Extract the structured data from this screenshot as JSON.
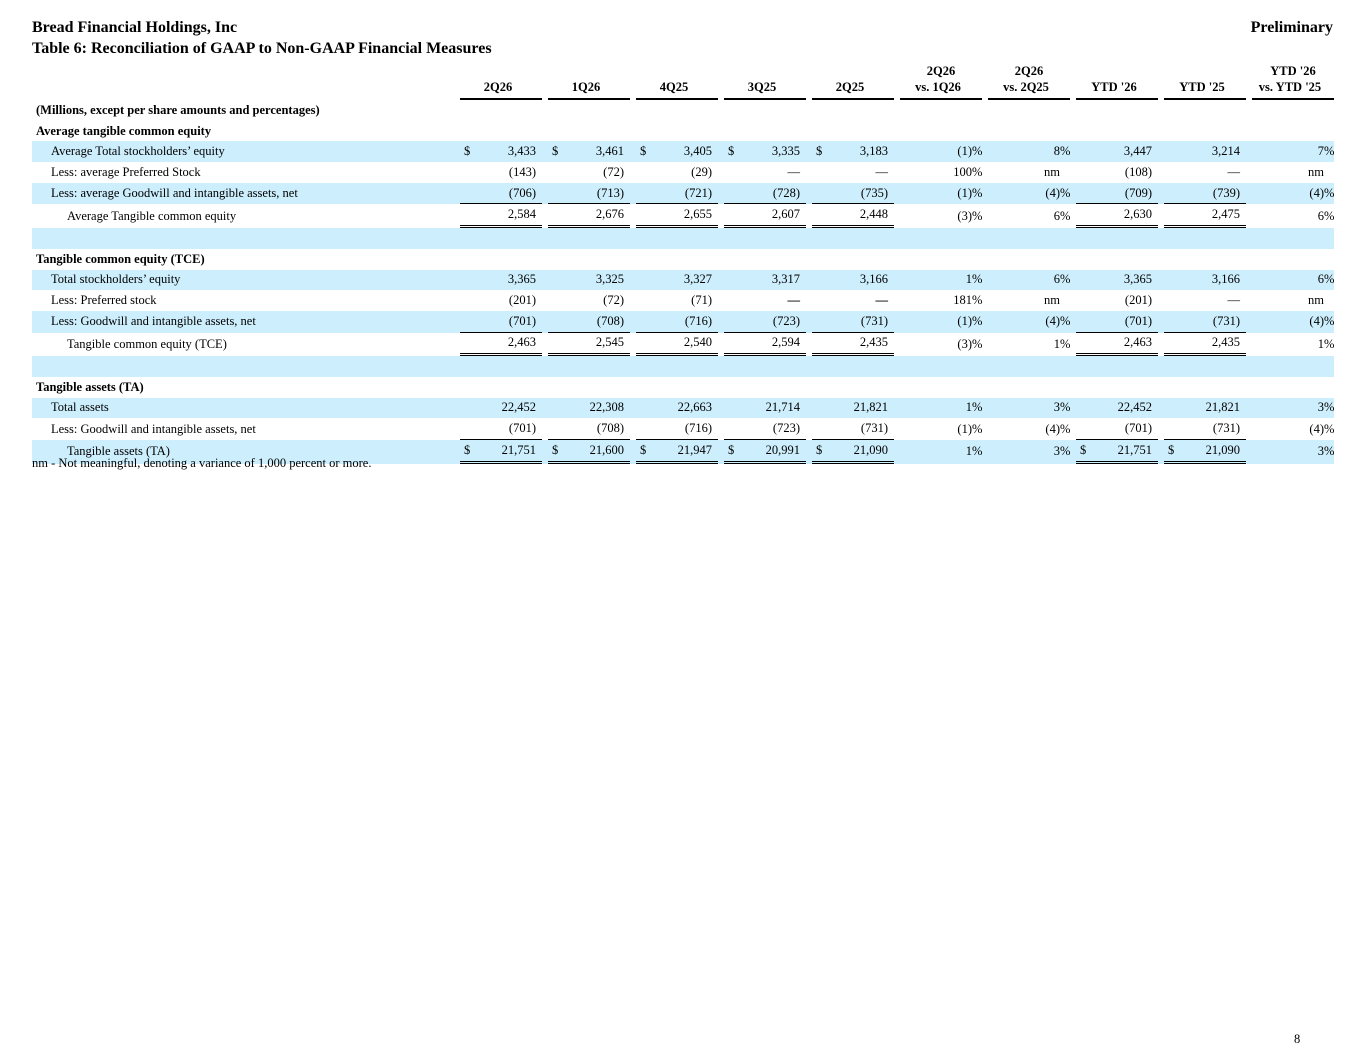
{
  "header": {
    "company": "Bread Financial Holdings, Inc",
    "status": "Preliminary",
    "table_title": "Table 6: Reconciliation of GAAP to Non-GAAP Financial Measures"
  },
  "columns": {
    "q1": "2Q26",
    "q2": "1Q26",
    "q3": "4Q25",
    "q4": "3Q25",
    "q5": "2Q25",
    "v1_top": "2Q26",
    "v1_bottom": "vs. 1Q26",
    "v2_top": "2Q26",
    "v2_bottom": "vs. 2Q25",
    "y1": "YTD '26",
    "y2": "YTD '25",
    "v3_top": "YTD '26",
    "v3_bottom": "vs. YTD '25"
  },
  "units_label": "(Millions, except per share amounts and percentages)",
  "currency_symbol": "$",
  "sections": {
    "atce": {
      "title": "Average tangible common equity",
      "r1": {
        "label": "Average Total stockholders’ equity",
        "q1": "3,433",
        "q2": "3,461",
        "q3": "3,405",
        "q4": "3,335",
        "q5": "3,183",
        "v1": "(1)",
        "v1t": "%",
        "v2": "8",
        "v2t": "%",
        "y1": "3,447",
        "y2": "3,214",
        "v3": "7",
        "v3t": "%"
      },
      "r2": {
        "label": "Less: average Preferred Stock",
        "q1": "(143)",
        "q2": "(72)",
        "q3": "(29)",
        "q4": "—",
        "q5": "—",
        "v1": "100",
        "v1t": "%",
        "v2": "nm",
        "v2t": "",
        "y1": "(108)",
        "y2": "—",
        "v3": "nm",
        "v3t": ""
      },
      "r3": {
        "label": "Less: average Goodwill and intangible assets, net",
        "q1": "(706)",
        "q2": "(713)",
        "q3": "(721)",
        "q4": "(728)",
        "q5": "(735)",
        "v1": "(1)",
        "v1t": "%",
        "v2": "(4)",
        "v2t": "%",
        "y1": "(709)",
        "y2": "(739)",
        "v3": "(4)",
        "v3t": "%"
      },
      "r4": {
        "label": "Average Tangible common equity",
        "q1": "2,584",
        "q2": "2,676",
        "q3": "2,655",
        "q4": "2,607",
        "q5": "2,448",
        "v1": "(3)",
        "v1t": "%",
        "v2": "6",
        "v2t": "%",
        "y1": "2,630",
        "y2": "2,475",
        "v3": "6",
        "v3t": "%"
      }
    },
    "tce": {
      "title": "Tangible common equity (TCE)",
      "r1": {
        "label": "Total stockholders’ equity",
        "q1": "3,365",
        "q2": "3,325",
        "q3": "3,327",
        "q4": "3,317",
        "q5": "3,166",
        "v1": "1",
        "v1t": "%",
        "v2": "6",
        "v2t": "%",
        "y1": "3,365",
        "y2": "3,166",
        "v3": "6",
        "v3t": "%"
      },
      "r2": {
        "label": "Less: Preferred stock",
        "q1": "(201)",
        "q2": "(72)",
        "q3": "(71)",
        "q4": "—",
        "q5": "—",
        "v1": "181",
        "v1t": "%",
        "v2": "nm",
        "v2t": "",
        "y1": "(201)",
        "y2": "—",
        "v3": "nm",
        "v3t": ""
      },
      "r3": {
        "label": "Less: Goodwill and intangible assets, net",
        "q1": "(701)",
        "q2": "(708)",
        "q3": "(716)",
        "q4": "(723)",
        "q5": "(731)",
        "v1": "(1)",
        "v1t": "%",
        "v2": "(4)",
        "v2t": "%",
        "y1": "(701)",
        "y2": "(731)",
        "v3": "(4)",
        "v3t": "%"
      },
      "r4": {
        "label": "Tangible common equity (TCE)",
        "q1": "2,463",
        "q2": "2,545",
        "q3": "2,540",
        "q4": "2,594",
        "q5": "2,435",
        "v1": "(3)",
        "v1t": "%",
        "v2": "1",
        "v2t": "%",
        "y1": "2,463",
        "y2": "2,435",
        "v3": "1",
        "v3t": "%"
      }
    },
    "ta": {
      "title": "Tangible assets (TA)",
      "r1": {
        "label": "Total assets",
        "q1": "22,452",
        "q2": "22,308",
        "q3": "22,663",
        "q4": "21,714",
        "q5": "21,821",
        "v1": "1",
        "v1t": "%",
        "v2": "3",
        "v2t": "%",
        "y1": "22,452",
        "y2": "21,821",
        "v3": "3",
        "v3t": "%"
      },
      "r2": {
        "label": "Less: Goodwill and intangible assets, net",
        "q1": "(701)",
        "q2": "(708)",
        "q3": "(716)",
        "q4": "(723)",
        "q5": "(731)",
        "v1": "(1)",
        "v1t": "%",
        "v2": "(4)",
        "v2t": "%",
        "y1": "(701)",
        "y2": "(731)",
        "v3": "(4)",
        "v3t": "%"
      },
      "r3": {
        "label": "Tangible assets (TA)",
        "q1": "21,751",
        "q2": "21,600",
        "q3": "21,947",
        "q4": "20,991",
        "q5": "21,090",
        "v1": "1",
        "v1t": "%",
        "v2": "3",
        "v2t": "%",
        "y1": "21,751",
        "y2": "21,090",
        "v3": "3",
        "v3t": "%"
      }
    }
  },
  "footnote": "nm - Not meaningful, denoting a variance of 1,000 percent or more.",
  "page_number": "8"
}
